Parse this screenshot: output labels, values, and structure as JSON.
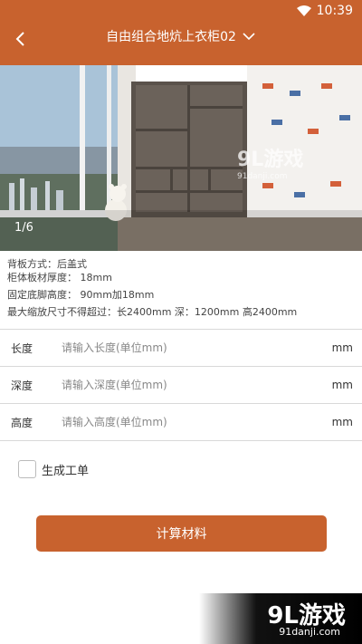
{
  "status_bar": {
    "time": "10:39",
    "icons": [
      "wifi-icon"
    ]
  },
  "header": {
    "title": "自由组合地炕上衣柜02",
    "back_icon": "back-arrow-icon",
    "dropdown_icon": "chevron-down-icon",
    "color": "#c8622e"
  },
  "gallery": {
    "counter": "1/6",
    "watermark_big": "9L游戏",
    "watermark_small": "91danji.com"
  },
  "specs": {
    "line1": "背板方式：后盖式",
    "line2": "柜体板材厚度： 18mm",
    "line3": "固定底脚高度： 90mm加18mm",
    "line4": "最大缩放尺寸不得超过：长2400mm 深：1200mm 高2400mm"
  },
  "form": {
    "length": {
      "label": "长度",
      "placeholder": "请输入长度(单位mm)",
      "unit": "mm"
    },
    "depth": {
      "label": "深度",
      "placeholder": "请输入深度(单位mm)",
      "unit": "mm"
    },
    "height": {
      "label": "高度",
      "placeholder": "请输入高度(单位mm)",
      "unit": "mm"
    }
  },
  "work_order": {
    "label": "生成工单",
    "checked": false
  },
  "calculate_button": {
    "label": "计算材料"
  },
  "brand_watermark": {
    "big": "9L游戏",
    "small": "91danji.com"
  }
}
